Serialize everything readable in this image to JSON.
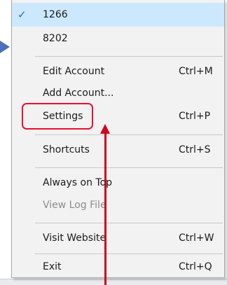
{
  "menu": {
    "accounts": [
      {
        "label": "1266",
        "checked": true
      },
      {
        "label": "8202",
        "checked": false
      }
    ],
    "items": {
      "edit_account": {
        "label": "Edit Account",
        "shortcut": "Ctrl+M"
      },
      "add_account": {
        "label": "Add Account..."
      },
      "settings": {
        "label": "Settings",
        "shortcut": "Ctrl+P"
      },
      "shortcuts": {
        "label": "Shortcuts",
        "shortcut": "Ctrl+S"
      },
      "always_on_top": {
        "label": "Always on Top"
      },
      "view_log_file": {
        "label": "View Log File",
        "disabled": true
      },
      "visit_website": {
        "label": "Visit Website",
        "shortcut": "Ctrl+W"
      },
      "exit": {
        "label": "Exit",
        "shortcut": "Ctrl+Q"
      }
    },
    "check_glyph": "✓"
  },
  "colors": {
    "menu_bg": "#f2f2f2",
    "checked_bg": "#cce8ff",
    "annotation_red": "#d0021b",
    "pointer_blue": "#4b72b8",
    "disabled_text": "#8c8c8c"
  },
  "icons": {
    "check": "checkmark-icon",
    "annotation_arrow": "red-up-arrow-icon",
    "pointer_arrow": "blue-right-arrow-icon"
  }
}
